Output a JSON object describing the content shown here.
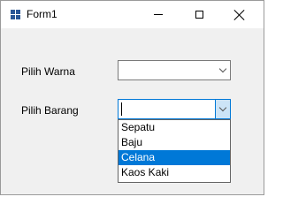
{
  "window": {
    "title": "Form1",
    "buttons": {
      "minimize": "minimize",
      "maximize": "maximize",
      "close": "close"
    }
  },
  "form": {
    "warna_label": "Pilih Warna",
    "warna_value": "",
    "barang_label": "Pilih Barang",
    "barang_value": "",
    "barang_options": [
      "Sepatu",
      "Baju",
      "Celana",
      "Kaos Kaki"
    ],
    "barang_highlighted": "Celana"
  },
  "colors": {
    "accent": "#0078d7",
    "window_bg": "#f0f0f0"
  },
  "icons": {
    "app": "form-icon",
    "dropdown": "chevron-down-icon"
  }
}
